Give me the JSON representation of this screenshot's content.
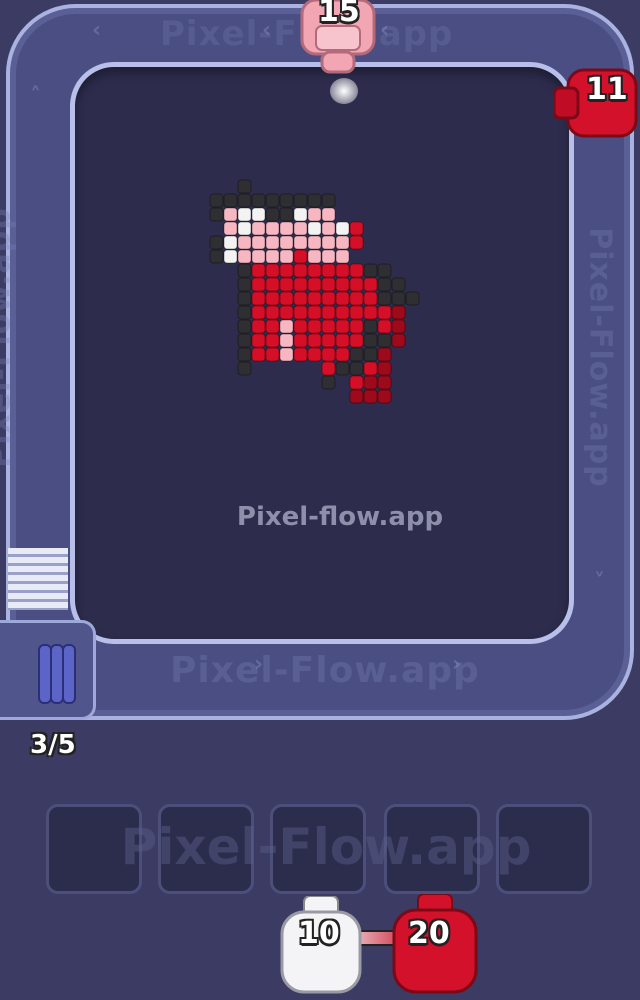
{
  "game": {
    "watermark": "Pixel-flow.app",
    "track_label_bottom": "Pixel-Flow.app",
    "track_label_top": "Pixel-Flow.app",
    "track_label_left": "Pixel-Flow.app",
    "track_label_right": "Pixel-Flow.app",
    "slots_label": "Pixel-Flow.app",
    "capacity": "3/5",
    "shooters_on_track": [
      {
        "id": "pink",
        "count": "15",
        "color": "#f2a6b4"
      },
      {
        "id": "red",
        "count": "11",
        "color": "#d3112b"
      }
    ],
    "queue": [
      {
        "id": "white",
        "count": "10",
        "color": "#f4f4f6"
      },
      {
        "id": "red",
        "count": "20",
        "color": "#d3112b"
      }
    ],
    "slots": [
      "",
      "",
      "",
      "",
      ""
    ],
    "palette": {
      "red": "#d60f28",
      "darkred": "#9c0a1c",
      "pink": "#f6b7c3",
      "white": "#f3f3f3",
      "black": "#2f2f33"
    }
  }
}
